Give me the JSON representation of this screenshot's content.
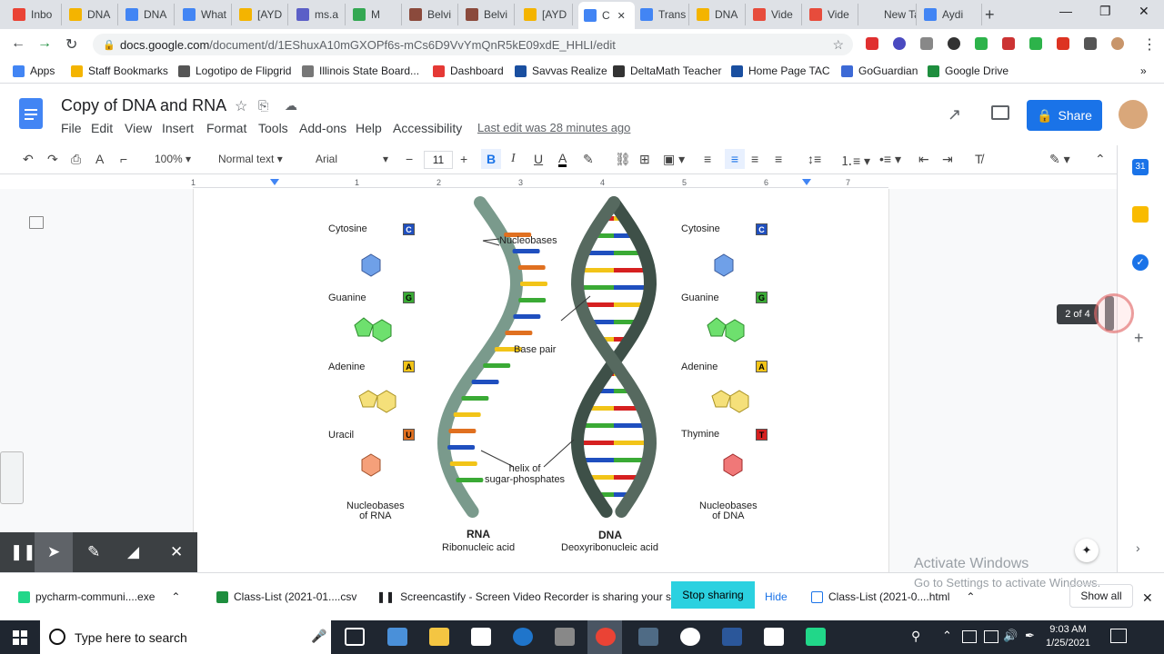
{
  "browser": {
    "tabs": [
      {
        "label": "Inbo",
        "color": "#ea4335"
      },
      {
        "label": "DNA",
        "color": "#f4b400"
      },
      {
        "label": "DNA",
        "color": "#4285f4"
      },
      {
        "label": "What",
        "color": "#4285f4"
      },
      {
        "label": "[AYD",
        "color": "#f4b400"
      },
      {
        "label": "ms.a",
        "color": "#5b5fc7"
      },
      {
        "label": "M",
        "color": "#34a853"
      },
      {
        "label": "Belvi",
        "color": "#8b4a3c"
      },
      {
        "label": "Belvi",
        "color": "#8b4a3c"
      },
      {
        "label": "[AYD",
        "color": "#f4b400"
      },
      {
        "label": "C",
        "color": "#4285f4"
      },
      {
        "label": "Trans",
        "color": "#4285f4"
      },
      {
        "label": "DNA",
        "color": "#f4b400"
      },
      {
        "label": "Vide",
        "color": "#e74c3c"
      },
      {
        "label": "Vide",
        "color": "#e74c3c"
      },
      {
        "label": "New Tab",
        "color": "#dee1e6"
      },
      {
        "label": "Aydi",
        "color": "#4285f4"
      }
    ],
    "url_host": "docs.google.com",
    "url_path": "/document/d/1EShuxA10mGXOPf6s-mCs6D9VvYmQnR5kE09xdE_HHLI/edit",
    "bookmarks": [
      "Apps",
      "Staff Bookmarks",
      "Logotipo de Flipgrid",
      "Illinois State Board...",
      "Dashboard",
      "Savvas Realize",
      "DeltaMath Teacher",
      "Home Page TAC",
      "GoGuardian",
      "Google Drive"
    ]
  },
  "doc": {
    "title": "Copy of DNA and RNA",
    "menus": [
      "File",
      "Edit",
      "View",
      "Insert",
      "Format",
      "Tools",
      "Add-ons",
      "Help",
      "Accessibility"
    ],
    "last_edit": "Last edit was 28 minutes ago",
    "share_label": "Share",
    "zoom": "100%",
    "style": "Normal text",
    "font": "Arial",
    "font_size": "11",
    "ruler_numbers": [
      "1",
      "1",
      "2",
      "3",
      "4",
      "5",
      "6",
      "7"
    ],
    "page_indicator": "2 of 4"
  },
  "figure": {
    "rna_bases": [
      "Cytosine",
      "Guanine",
      "Adenine",
      "Uracil"
    ],
    "rna_letters": [
      "C",
      "G",
      "A",
      "U"
    ],
    "dna_bases": [
      "Cytosine",
      "Guanine",
      "Adenine",
      "Thymine"
    ],
    "dna_letters": [
      "C",
      "G",
      "A",
      "T"
    ],
    "nucleobases_label": "Nucleobases",
    "base_pair_label": "Base pair",
    "helix_label": "helix of\nsugar-phosphates",
    "rna_caption": "Nucleobases\nof RNA",
    "dna_caption": "Nucleobases\nof DNA",
    "rna_title": "RNA",
    "rna_sub": "Ribonucleic acid",
    "dna_title": "DNA",
    "dna_sub": "Deoxyribonucleic acid",
    "colors": {
      "C": "#1f4fbf",
      "G": "#3aaa35",
      "A": "#f2c418",
      "U": "#e07020",
      "T": "#d62020"
    }
  },
  "screencast": {
    "message": "Screencastify - Screen Video Recorder is sharing your screen.",
    "stop_label": "Stop sharing",
    "hide_label": "Hide"
  },
  "downloads": {
    "items": [
      "pycharm-communi....exe",
      "Class-List (2021-01....csv",
      "Class-List (2021-0....html"
    ],
    "show_all": "Show all"
  },
  "windows": {
    "watermark_title": "Activate Windows",
    "watermark_sub": "Go to Settings to activate Windows.",
    "search_placeholder": "Type here to search",
    "time": "9:03 AM",
    "date": "1/25/2021"
  }
}
